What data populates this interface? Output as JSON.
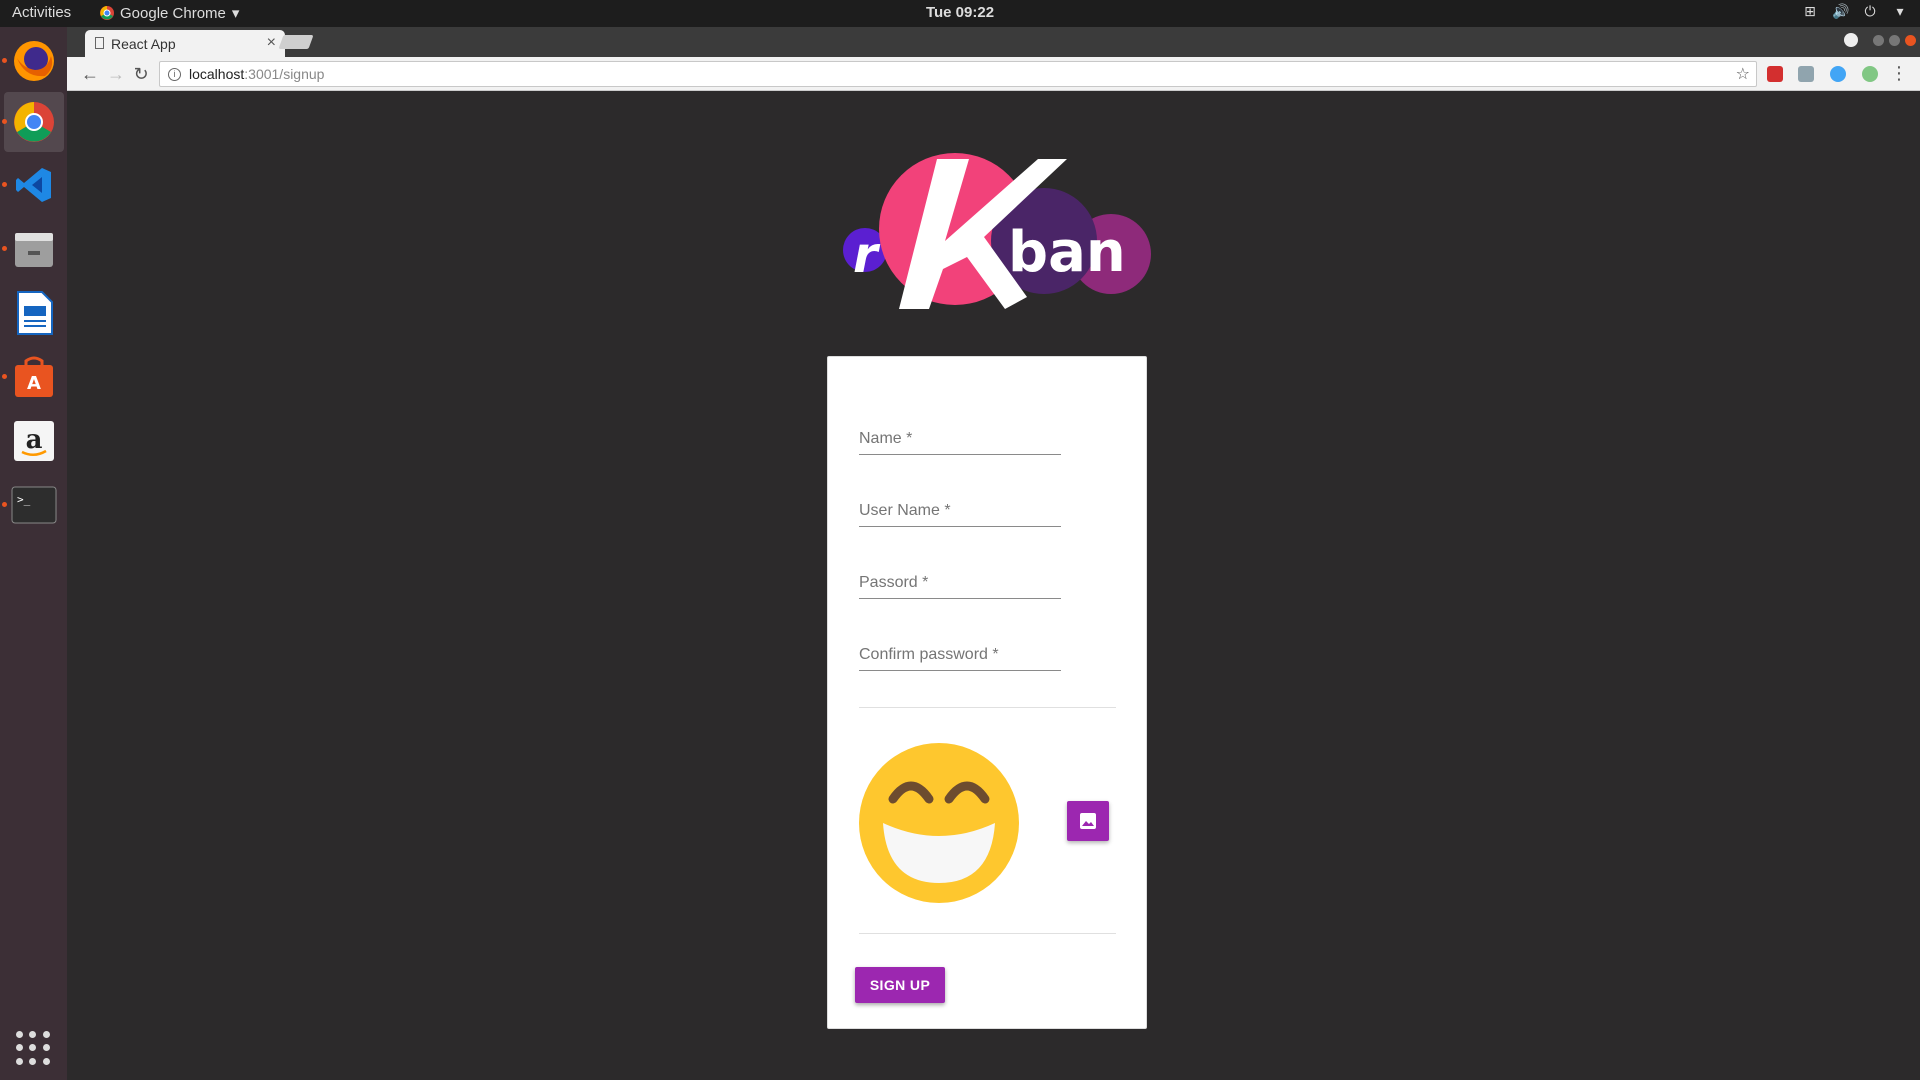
{
  "system": {
    "activities_label": "Activities",
    "app_name": "Google Chrome",
    "clock": "Tue 09:22"
  },
  "dock": {
    "items": [
      {
        "name": "firefox-icon",
        "running": true
      },
      {
        "name": "chrome-icon",
        "running": true,
        "active": true
      },
      {
        "name": "vscode-icon",
        "running": true
      },
      {
        "name": "files-icon",
        "running": true
      },
      {
        "name": "writer-icon",
        "running": false
      },
      {
        "name": "software-center-icon",
        "running": true
      },
      {
        "name": "amazon-icon",
        "running": false
      },
      {
        "name": "terminal-icon",
        "running": true
      }
    ]
  },
  "browser": {
    "tab_title": "React App",
    "url_host": "localhost",
    "url_path": ":3001/signup"
  },
  "logo": {
    "letters": [
      "r",
      "K",
      "ban"
    ],
    "colors": [
      "#5b1fd1",
      "#f2427a",
      "#4a2567",
      "#8e2a7a"
    ]
  },
  "form": {
    "fields": [
      {
        "label": "Name *"
      },
      {
        "label": "User Name *"
      },
      {
        "label": "Passord *"
      },
      {
        "label": "Confirm password *"
      }
    ],
    "submit_label": "SIGN UP",
    "accent": "#9c27b0"
  }
}
